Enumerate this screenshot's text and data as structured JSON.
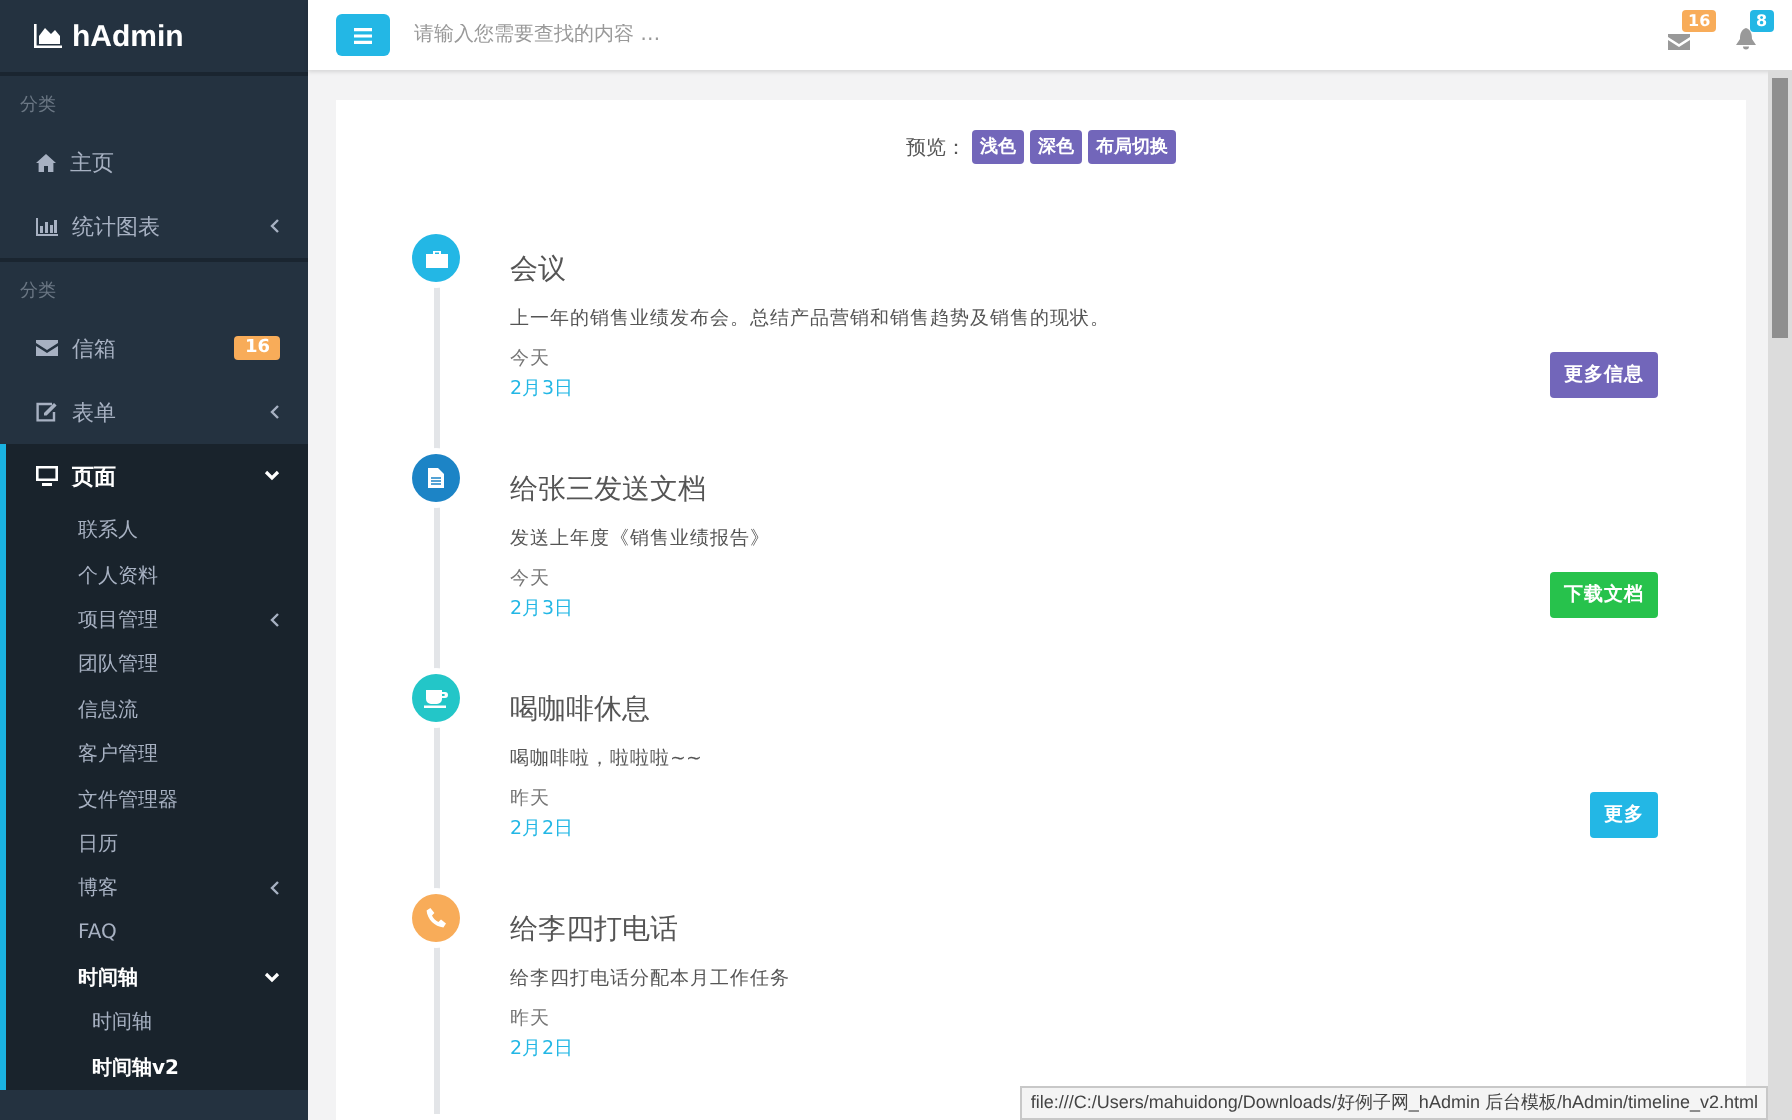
{
  "sidebar": {
    "brand": "hAdmin",
    "sections": [
      {
        "heading": "分类",
        "items": [
          {
            "label": "主页",
            "selected": false
          },
          {
            "label": "统计图表",
            "selected": false,
            "expanded": false
          }
        ]
      },
      {
        "heading": "分类",
        "items": [
          {
            "label": "信箱",
            "selected": false,
            "badge": "16"
          },
          {
            "label": "表单",
            "selected": false,
            "expanded": false
          },
          {
            "label": "页面",
            "selected": false,
            "expanded": true,
            "children": [
              {
                "label": "联系人",
                "selected": false
              },
              {
                "label": "个人资料",
                "selected": false
              },
              {
                "label": "项目管理",
                "selected": false,
                "expanded": false
              },
              {
                "label": "团队管理",
                "selected": false
              },
              {
                "label": "信息流",
                "selected": false
              },
              {
                "label": "客户管理",
                "selected": false
              },
              {
                "label": "文件管理器",
                "selected": false
              },
              {
                "label": "日历",
                "selected": false
              },
              {
                "label": "博客",
                "selected": false,
                "expanded": false
              },
              {
                "label": "FAQ",
                "selected": false
              },
              {
                "label": "时间轴",
                "selected": false,
                "expanded": true,
                "children": [
                  {
                    "label": "时间轴",
                    "selected": false
                  },
                  {
                    "label": "时间轴v2",
                    "selected": true
                  }
                ]
              }
            ]
          }
        ]
      }
    ]
  },
  "topbar": {
    "search": {
      "placeholder": "请输入您需要查找的内容 …"
    },
    "messages_badge": "16",
    "notifications_badge": "8"
  },
  "preview": {
    "label": "预览：",
    "buttons": [
      "浅色",
      "深色",
      "布局切换"
    ]
  },
  "timeline": [
    {
      "title": "会议",
      "text": "上一年的销售业绩发布会。总结产品营销和销售趋势及销售的现状。",
      "day": "今天",
      "date": "2月3日",
      "color": "#23b7e5",
      "button": {
        "label": "更多信息",
        "color": "#7266ba"
      }
    },
    {
      "title": "给张三发送文档",
      "text": "发送上年度《销售业绩报告》",
      "day": "今天",
      "date": "2月3日",
      "color": "#1c84c6",
      "button": {
        "label": "下载文档",
        "color": "#27c24c"
      }
    },
    {
      "title": "喝咖啡休息",
      "text": "喝咖啡啦，啦啦啦~~",
      "day": "昨天",
      "date": "2月2日",
      "color": "#23c6c8",
      "button": {
        "label": "更多",
        "color": "#23b7e5"
      }
    },
    {
      "title": "给李四打电话",
      "text": "给李四打电话分配本月工作任务",
      "day": "昨天",
      "date": "2月2日",
      "color": "#f8ac59"
    }
  ],
  "status_bar": "file:///C:/Users/mahuidong/Downloads/好例子网_hAdmin 后台模板/hAdmin/timeline_v2.html"
}
